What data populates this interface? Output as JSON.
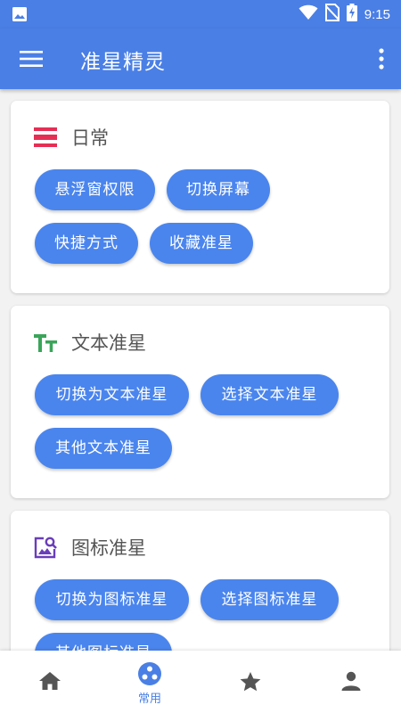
{
  "status_bar": {
    "time": "9:15"
  },
  "app_bar": {
    "title": "准星精灵"
  },
  "cards": [
    {
      "title": "日常",
      "buttons": [
        "悬浮窗权限",
        "切换屏幕",
        "快捷方式",
        "收藏准星"
      ]
    },
    {
      "title": "文本准星",
      "buttons": [
        "切换为文本准星",
        "选择文本准星",
        "其他文本准星"
      ]
    },
    {
      "title": "图标准星",
      "buttons": [
        "切换为图标准星",
        "选择图标准星",
        "其他图标准星"
      ]
    }
  ],
  "bottom_nav": {
    "items": [
      {
        "icon": "home-icon",
        "label": ""
      },
      {
        "icon": "common-icon",
        "label": "常用",
        "active": true
      },
      {
        "icon": "star-icon",
        "label": ""
      },
      {
        "icon": "person-icon",
        "label": ""
      }
    ]
  },
  "colors": {
    "primary": "#4a7fe5",
    "chip": "#4a85ee",
    "daily_icon": "#e62e55",
    "text_icon": "#3aa55a",
    "image_icon": "#6a3dbb"
  }
}
